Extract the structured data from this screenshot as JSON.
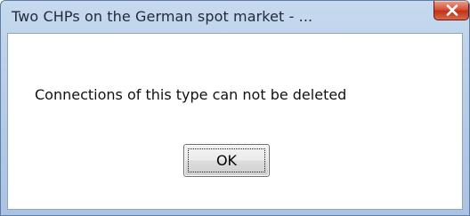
{
  "window": {
    "title": "Two CHPs on the German spot market - ...",
    "close_icon": "close-icon"
  },
  "dialog": {
    "message": "Connections of this type can not be deleted",
    "ok_label": "OK"
  },
  "colors": {
    "titlebar": "#b7cde8",
    "close_button": "#c2321a",
    "client_background": "#ffffff"
  }
}
